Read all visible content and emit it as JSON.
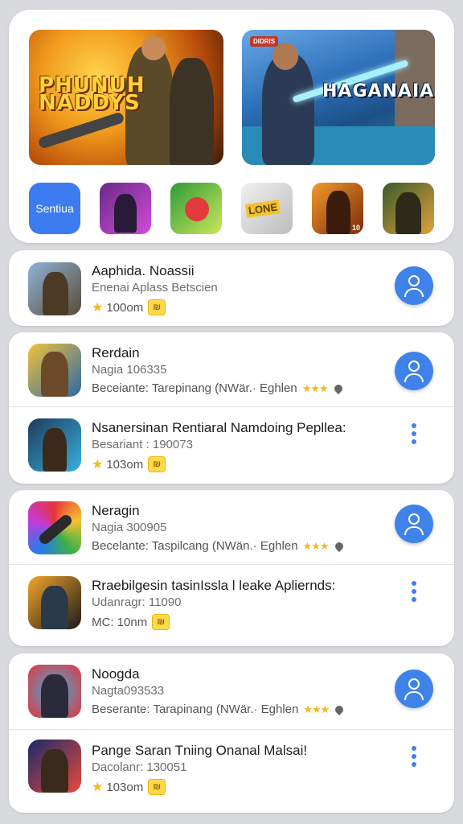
{
  "featured": {
    "banners": [
      {
        "title_line1": "PHUNUH",
        "title_line2": "NADDYS"
      },
      {
        "badge": "DIDRIS",
        "title": "HAGANAIA"
      }
    ],
    "main_tile_label": "Sentiua",
    "tiles": [
      {
        "icon": "game-icon-purple"
      },
      {
        "icon": "game-icon-green"
      },
      {
        "icon": "game-icon-logo",
        "label": "LONE"
      },
      {
        "icon": "game-icon-orange",
        "badge": "10"
      },
      {
        "icon": "game-icon-soldier"
      }
    ]
  },
  "lists": [
    {
      "rows": [
        {
          "title": "Aaphida. Noassii",
          "subtitle": "Enenai Aplass Betscien",
          "rating_text": "100om",
          "action": "user-icon"
        }
      ]
    },
    {
      "rows": [
        {
          "title": "Rerdain",
          "subtitle": "Nagia 106335",
          "meta": "Beceiante: Tarepinang (NWär.· Eghlen",
          "action": "user-icon"
        },
        {
          "title": "Nsanersinan Rentiaral Namdoing Pepllea:",
          "subtitle": "Besariant : 190073",
          "rating_text": "103om",
          "action": "more-icon"
        }
      ]
    },
    {
      "rows": [
        {
          "title": "Neragin",
          "subtitle": "Nagia 300905",
          "meta": "Becelante: Taspilcang (NWän.· Eghlen",
          "action": "user-icon"
        },
        {
          "title": "Rraebilgesin tasinIssla l leake Apliernds:",
          "subtitle": "Udanragr: 11090",
          "rating_text": "MC: 10nm",
          "action": "more-icon"
        }
      ]
    },
    {
      "rows": [
        {
          "title": "Noogda",
          "subtitle": "Nagta093533",
          "meta": "Beserante: Tarapinang (NWär.· Eghlen",
          "action": "user-icon"
        },
        {
          "title": "Pange Saran Tniing Onanal Malsai!",
          "subtitle": "Dacolanr: 130051",
          "rating_text": "103om",
          "action": "more-icon"
        }
      ]
    }
  ],
  "colors": {
    "accent": "#3f82ea",
    "star": "#f5b917",
    "background": "#d9dadd"
  }
}
